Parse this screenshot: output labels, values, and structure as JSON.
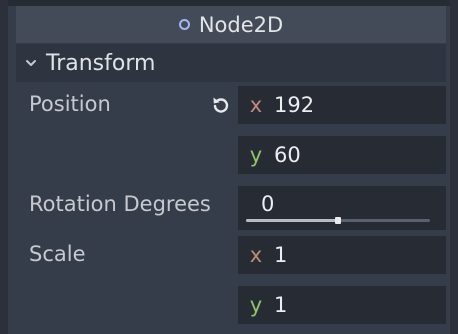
{
  "inspector": {
    "class_name": "Node2D",
    "section_title": "Transform",
    "properties": {
      "position": {
        "label": "Position",
        "x_axis": "x",
        "x_value": "192",
        "y_axis": "y",
        "y_value": "60"
      },
      "rotation": {
        "label": "Rotation Degrees",
        "value": "0",
        "slider_level": 0.5
      },
      "scale": {
        "label": "Scale",
        "x_axis": "x",
        "x_value": "1",
        "y_axis": "y",
        "y_value": "1"
      }
    }
  },
  "colors": {
    "background": "#363d4a",
    "field": "#262b34",
    "x_axis": "#c48a7c",
    "y_axis": "#93c26e",
    "node_icon": "#a5b7f3"
  },
  "icons": {
    "class": "node2d-icon",
    "section": "chevron-down-icon",
    "revert": "revert-icon"
  }
}
